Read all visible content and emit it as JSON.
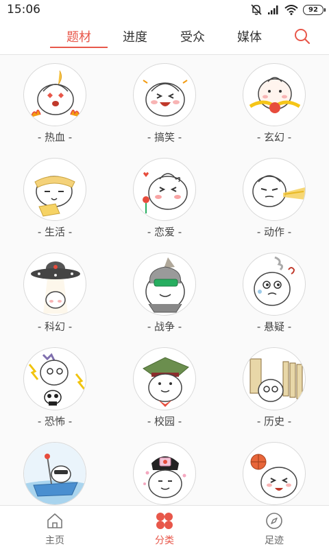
{
  "status_bar": {
    "time": "15:06",
    "battery": "92",
    "icons": [
      "mute-icon",
      "signal-icon",
      "wifi-icon",
      "battery-icon"
    ]
  },
  "tabs": [
    {
      "label": "题材",
      "active": true
    },
    {
      "label": "进度",
      "active": false
    },
    {
      "label": "受众",
      "active": false
    },
    {
      "label": "媒体",
      "active": false
    }
  ],
  "search": {
    "icon": "search-icon"
  },
  "categories": [
    {
      "label": "- 热血 -",
      "icon": "fire-bun"
    },
    {
      "label": "- 搞笑 -",
      "icon": "laugh-bun"
    },
    {
      "label": "- 玄幻 -",
      "icon": "fantasy-bun"
    },
    {
      "label": "- 生活 -",
      "icon": "life-bun"
    },
    {
      "label": "- 恋爱 -",
      "icon": "love-bun"
    },
    {
      "label": "- 动作 -",
      "icon": "action-bun"
    },
    {
      "label": "- 科幻 -",
      "icon": "scifi-bun"
    },
    {
      "label": "- 战争 -",
      "icon": "war-bun"
    },
    {
      "label": "- 悬疑 -",
      "icon": "mystery-bun"
    },
    {
      "label": "- 恐怖 -",
      "icon": "horror-bun"
    },
    {
      "label": "- 校园 -",
      "icon": "campus-bun"
    },
    {
      "label": "- 历史 -",
      "icon": "history-bun"
    },
    {
      "label": "",
      "icon": "boat-bun"
    },
    {
      "label": "",
      "icon": "palace-bun"
    },
    {
      "label": "",
      "icon": "sports-bun"
    }
  ],
  "bottom_nav": [
    {
      "label": "主页",
      "icon": "home-icon",
      "active": false
    },
    {
      "label": "分类",
      "icon": "category-icon",
      "active": true
    },
    {
      "label": "足迹",
      "icon": "compass-icon",
      "active": false
    }
  ],
  "colors": {
    "accent": "#e8574a",
    "border": "#d8d8d8",
    "text": "#333333",
    "background": "#fafafa"
  }
}
